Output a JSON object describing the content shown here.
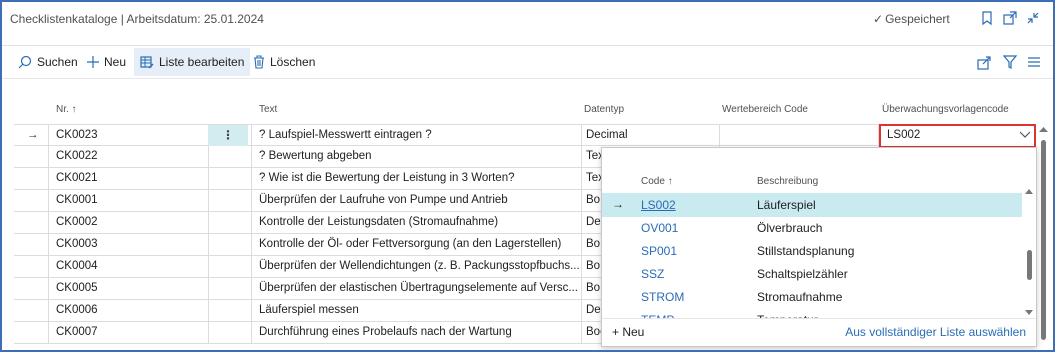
{
  "window": {
    "title": "Checklistenkataloge | Arbeitsdatum: 25.01.2024",
    "saved_label": "Gespeichert"
  },
  "actions": {
    "search": "Suchen",
    "new": "Neu",
    "edit_list": "Liste bearbeiten",
    "delete": "Löschen"
  },
  "table": {
    "headers": {
      "nr": "Nr. ↑",
      "text": "Text",
      "datatype": "Datentyp",
      "value_range": "Wertebereich Code",
      "template": "Überwachungsvorlagencode"
    },
    "rows": [
      {
        "nr": "CK0023",
        "text": "? Laufspiel-Messwertt eintragen ?",
        "datatype": "Decimal",
        "template": "LS002"
      },
      {
        "nr": "CK0022",
        "text": "? Bewertung abgeben",
        "datatype": "Tex"
      },
      {
        "nr": "CK0021",
        "text": "? Wie ist die Bewertung der Leistung in 3 Worten?",
        "datatype": "Tex"
      },
      {
        "nr": "CK0001",
        "text": "Überprüfen der Laufruhe von Pumpe und Antrieb",
        "datatype": "Bo"
      },
      {
        "nr": "CK0002",
        "text": "Kontrolle der Leistungsdaten (Stromaufnahme)",
        "datatype": "De"
      },
      {
        "nr": "CK0003",
        "text": "Kontrolle der Öl- oder Fettversorgung (an den Lagerstellen)",
        "datatype": "Bo"
      },
      {
        "nr": "CK0004",
        "text": "Überprüfen der Wellendichtungen (z. B. Packungsstopfbuchs...",
        "datatype": "Bo"
      },
      {
        "nr": "CK0005",
        "text": "Überprüfen der elastischen Übertragungselemente auf Versc...",
        "datatype": "Bo"
      },
      {
        "nr": "CK0006",
        "text": "Läuferspiel messen",
        "datatype": "De"
      },
      {
        "nr": "CK0007",
        "text": "Durchführung eines Probelaufs nach der Wartung",
        "datatype": "Boolean"
      }
    ]
  },
  "lookup": {
    "headers": {
      "code": "Code ↑",
      "description": "Beschreibung"
    },
    "items": [
      {
        "code": "LS002",
        "description": "Läuferspiel"
      },
      {
        "code": "OV001",
        "description": "Ölverbrauch"
      },
      {
        "code": "SP001",
        "description": "Stillstandsplanung"
      },
      {
        "code": "SSZ",
        "description": "Schaltspielzähler"
      },
      {
        "code": "STROM",
        "description": "Stromaufnahme"
      },
      {
        "code": "TEMP",
        "description": "Temperatur"
      }
    ],
    "new_label": "Neu",
    "full_list_label": "Aus vollständiger Liste auswählen"
  },
  "colors": {
    "accent": "#2a6cb5",
    "selected_row": "#c9ebf0",
    "error_border": "#d33333"
  }
}
